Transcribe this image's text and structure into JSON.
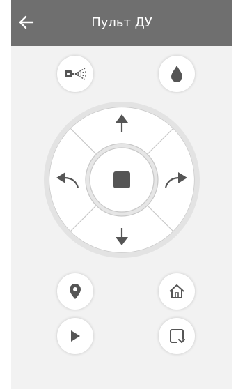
{
  "header": {
    "title": "Пульт ДУ",
    "back_icon": "arrow-left-icon",
    "background_color": "#6f6f6f"
  },
  "top_buttons": [
    {
      "name": "spray-button",
      "icon": "spray-icon"
    },
    {
      "name": "water-button",
      "icon": "water-drop-icon"
    }
  ],
  "dpad": {
    "up_icon": "arrow-up-icon",
    "down_icon": "arrow-down-icon",
    "left_icon": "turn-left-icon",
    "right_icon": "turn-right-icon",
    "center_icon": "stop-square-icon"
  },
  "bottom_buttons": [
    {
      "name": "locate-button",
      "icon": "location-pin-icon"
    },
    {
      "name": "home-button",
      "icon": "home-icon"
    },
    {
      "name": "play-button",
      "icon": "play-icon"
    },
    {
      "name": "edge-clean-button",
      "icon": "edge-square-icon"
    }
  ],
  "colors": {
    "screen_background": "#f2f2f2",
    "icon": "#555555",
    "button_background": "#ffffff"
  }
}
